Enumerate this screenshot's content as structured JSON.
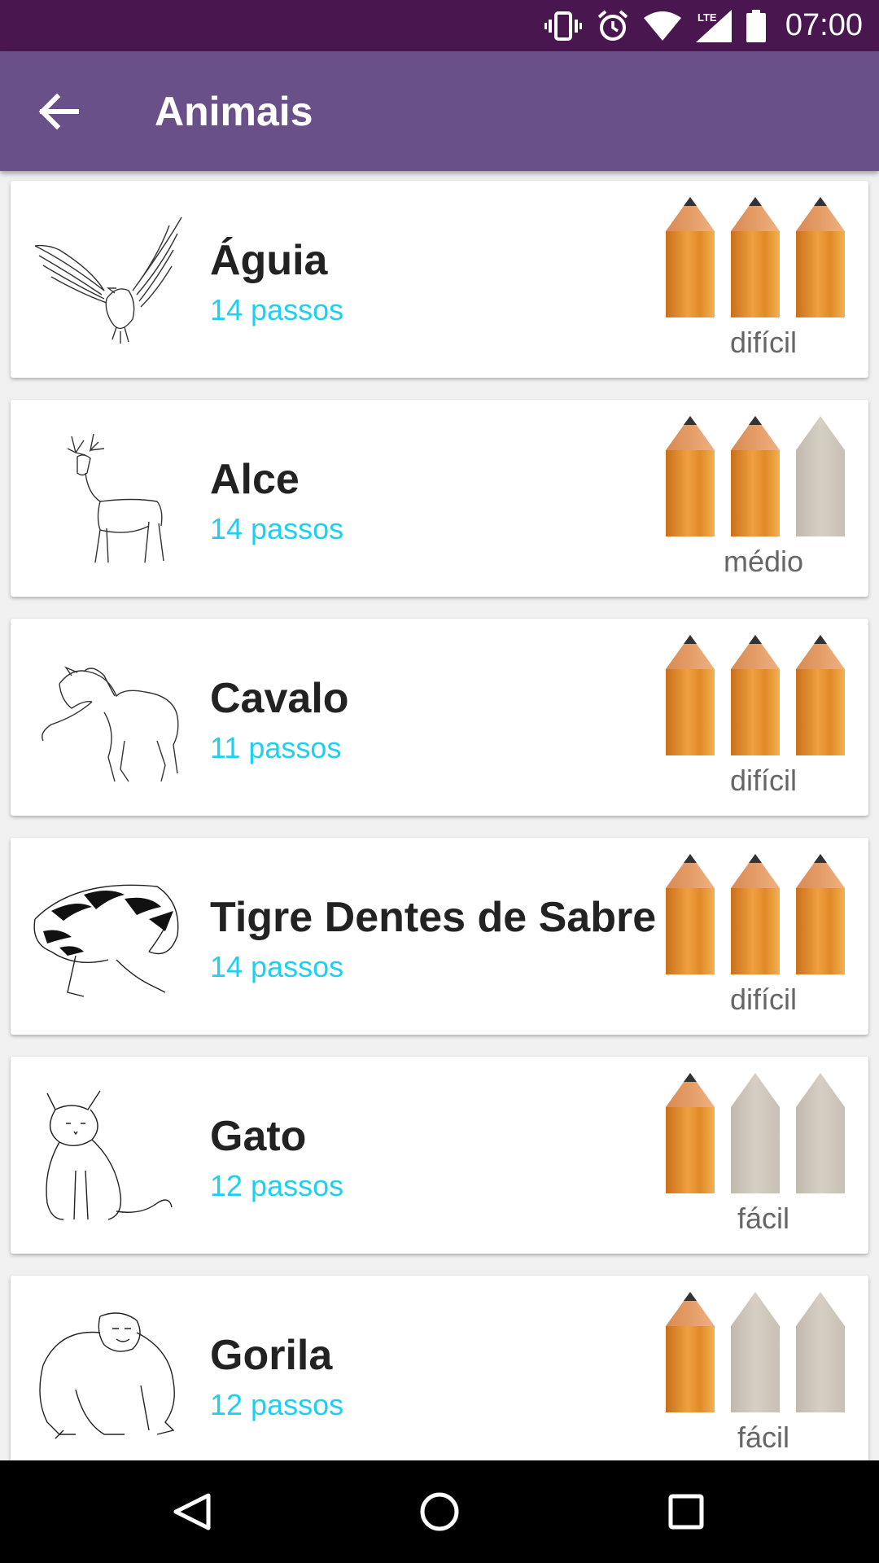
{
  "status_bar": {
    "time": "07:00",
    "icons": [
      "vibrate-icon",
      "alarm-icon",
      "wifi-icon",
      "lte-signal-icon",
      "battery-icon"
    ],
    "lte_label": "LTE"
  },
  "app_bar": {
    "title": "Animais",
    "back_icon": "arrow-left-icon"
  },
  "colors": {
    "status_bar": "#4a1650",
    "app_bar": "#6a5088",
    "steps_text": "#1ed0f0",
    "pencil_active": "#e08a28",
    "pencil_inactive": "#ccc4b8"
  },
  "items": [
    {
      "name": "Águia",
      "steps": "14 passos",
      "difficulty": "difícil",
      "level": 3,
      "max_level": 3,
      "thumbnail": "eagle-drawing"
    },
    {
      "name": "Alce",
      "steps": "14 passos",
      "difficulty": "médio",
      "level": 2,
      "max_level": 3,
      "thumbnail": "moose-drawing"
    },
    {
      "name": "Cavalo",
      "steps": "11 passos",
      "difficulty": "difícil",
      "level": 3,
      "max_level": 3,
      "thumbnail": "horse-drawing"
    },
    {
      "name": "Tigre Dentes de Sabre",
      "steps": "14 passos",
      "difficulty": "difícil",
      "level": 3,
      "max_level": 3,
      "thumbnail": "sabertooth-drawing"
    },
    {
      "name": "Gato",
      "steps": "12 passos",
      "difficulty": "fácil",
      "level": 1,
      "max_level": 3,
      "thumbnail": "cat-drawing"
    },
    {
      "name": "Gorila",
      "steps": "12 passos",
      "difficulty": "fácil",
      "level": 1,
      "max_level": 3,
      "thumbnail": "gorilla-drawing"
    }
  ],
  "nav_bar": {
    "buttons": [
      "back-triangle-icon",
      "home-circle-icon",
      "recents-square-icon"
    ]
  }
}
